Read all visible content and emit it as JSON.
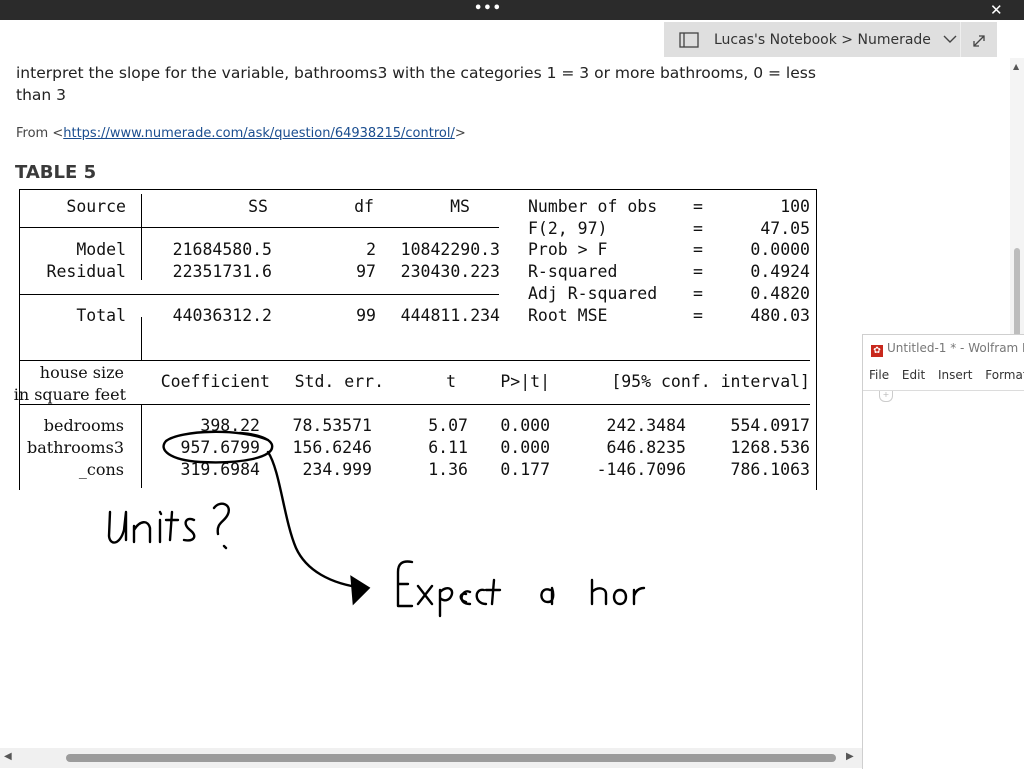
{
  "window": {
    "more_label": "•••",
    "close_label": "✕"
  },
  "notebook": {
    "breadcrumb": "Lucas's Notebook > Numerade",
    "dropdown_icon": "chevron-down-icon",
    "expand_icon": "expand-icon"
  },
  "question": {
    "text": "interpret the slope for the variable, bathrooms3 with the categories 1 = 3 or more bathrooms, 0 = less than 3",
    "source_prefix": "From <",
    "source_url": "https://www.numerade.com/ask/question/64938215/control/",
    "source_suffix": ">"
  },
  "table": {
    "title": "TABLE 5",
    "anova_headers": {
      "source": "Source",
      "ss": "SS",
      "df": "df",
      "ms": "MS"
    },
    "anova_rows": [
      {
        "source": "Model",
        "ss": "21684580.5",
        "df": "2",
        "ms": "10842290.3"
      },
      {
        "source": "Residual",
        "ss": "22351731.6",
        "df": "97",
        "ms": "230430.223"
      },
      {
        "source": "Total",
        "ss": "44036312.2",
        "df": "99",
        "ms": "444811.234"
      }
    ],
    "stats": [
      {
        "label": "Number of obs",
        "eq": "=",
        "value": "100"
      },
      {
        "label": "F(2, 97)",
        "eq": "=",
        "value": "47.05"
      },
      {
        "label": "Prob > F",
        "eq": "=",
        "value": "0.0000"
      },
      {
        "label": "R-squared",
        "eq": "=",
        "value": "0.4924"
      },
      {
        "label": "Adj R-squared",
        "eq": "=",
        "value": "0.4820"
      },
      {
        "label": "Root MSE",
        "eq": "=",
        "value": "480.03"
      }
    ],
    "coef_headers": {
      "depvar_line1": "house size",
      "depvar_line2": "in square feet",
      "coef": "Coefficient",
      "se": "Std. err.",
      "t": "t",
      "p": "P>|t|",
      "ci": "[95% conf. interval]"
    },
    "coef_rows": [
      {
        "var": "bedrooms",
        "coef": "398.22",
        "se": "78.53571",
        "t": "5.07",
        "p": "0.000",
        "lo": "242.3484",
        "hi": "554.0917"
      },
      {
        "var": "bathrooms3",
        "coef": "957.6799",
        "se": "156.6246",
        "t": "6.11",
        "p": "0.000",
        "lo": "646.8235",
        "hi": "1268.536"
      },
      {
        "var": "_cons",
        "coef": "319.6984",
        "se": "234.999",
        "t": "1.36",
        "p": "0.177",
        "lo": "-146.7096",
        "hi": "786.1063"
      }
    ]
  },
  "wolfram": {
    "title": "Untitled-1 * - Wolfram M",
    "icon": "wolfram-icon",
    "menu": [
      "File",
      "Edit",
      "Insert",
      "Format"
    ]
  },
  "colors": {
    "topbar": "#2b2b2b",
    "breadcrumb_bg": "#dfdfdf",
    "link": "#1a4d8f",
    "wolfram_red": "#c8281c"
  }
}
